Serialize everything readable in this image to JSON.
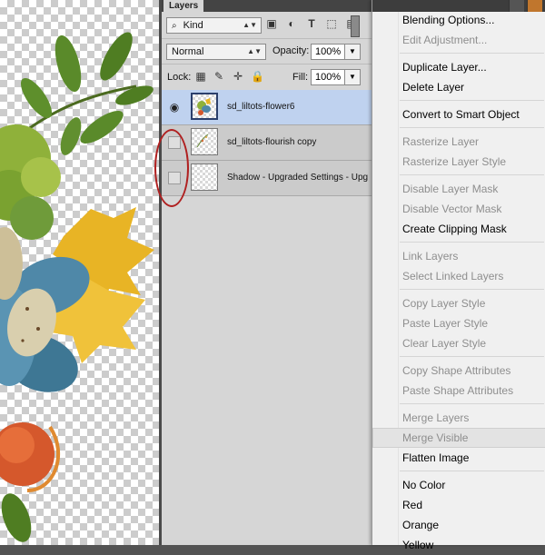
{
  "panel": {
    "tab": "Layers",
    "filter": {
      "kind_label": "Kind",
      "icons": [
        "pixel-filter-icon",
        "adjustment-filter-icon",
        "type-filter-icon",
        "shape-filter-icon",
        "smart-object-filter-icon",
        "filter-toggle-icon"
      ]
    },
    "blend_mode": "Normal",
    "opacity_label": "Opacity:",
    "opacity_value": "100%",
    "lock_label": "Lock:",
    "lock_icons": [
      "lock-transparent-icon",
      "lock-image-icon",
      "lock-position-icon",
      "lock-all-icon"
    ],
    "fill_label": "Fill:",
    "fill_value": "100%"
  },
  "layers": [
    {
      "name": "sd_liltots-flower6",
      "visible": true,
      "selected": true
    },
    {
      "name": "sd_liltots-flourish copy",
      "visible": false,
      "selected": false
    },
    {
      "name": "Shadow - Upgraded Settings - Upg",
      "visible": false,
      "selected": false
    }
  ],
  "context_menu": {
    "items": [
      {
        "label": "Blending Options...",
        "enabled": true
      },
      {
        "label": "Edit Adjustment...",
        "enabled": false
      },
      {
        "sep": true
      },
      {
        "label": "Duplicate Layer...",
        "enabled": true
      },
      {
        "label": "Delete Layer",
        "enabled": true
      },
      {
        "sep": true
      },
      {
        "label": "Convert to Smart Object",
        "enabled": true
      },
      {
        "sep": true
      },
      {
        "label": "Rasterize Layer",
        "enabled": false
      },
      {
        "label": "Rasterize Layer Style",
        "enabled": false
      },
      {
        "sep": true
      },
      {
        "label": "Disable Layer Mask",
        "enabled": false
      },
      {
        "label": "Disable Vector Mask",
        "enabled": false
      },
      {
        "label": "Create Clipping Mask",
        "enabled": true
      },
      {
        "sep": true
      },
      {
        "label": "Link Layers",
        "enabled": false
      },
      {
        "label": "Select Linked Layers",
        "enabled": false
      },
      {
        "sep": true
      },
      {
        "label": "Copy Layer Style",
        "enabled": false
      },
      {
        "label": "Paste Layer Style",
        "enabled": false
      },
      {
        "label": "Clear Layer Style",
        "enabled": false
      },
      {
        "sep": true
      },
      {
        "label": "Copy Shape Attributes",
        "enabled": false
      },
      {
        "label": "Paste Shape Attributes",
        "enabled": false
      },
      {
        "sep": true
      },
      {
        "label": "Merge Layers",
        "enabled": false
      },
      {
        "label": "Merge Visible",
        "enabled": false,
        "hover": true
      },
      {
        "label": "Flatten Image",
        "enabled": true
      },
      {
        "sep": true
      },
      {
        "label": "No Color",
        "enabled": true
      },
      {
        "label": "Red",
        "enabled": true
      },
      {
        "label": "Orange",
        "enabled": true
      },
      {
        "label": "Yellow",
        "enabled": true
      }
    ]
  },
  "colors": {
    "selected_row": "#bfd2ef",
    "annotation": "#b02020"
  }
}
